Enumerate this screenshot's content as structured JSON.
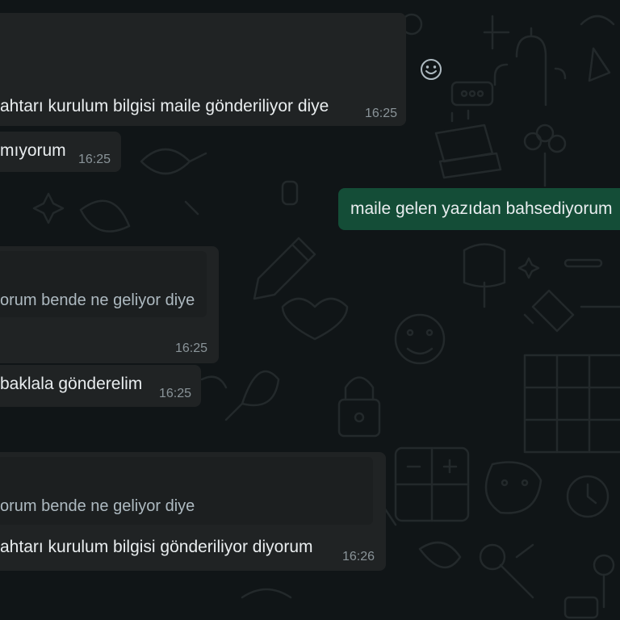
{
  "colors": {
    "background": "#101517",
    "incoming_bubble": "#202324",
    "outgoing_bubble": "#144d37",
    "quote_bubble": "#1c1f20",
    "text": "#e9edef",
    "timestamp": "#8a9499"
  },
  "reaction_icon": "emoji-smile-icon",
  "messages": [
    {
      "direction": "incoming",
      "text": "ahtarı kurulum bilgisi maile gönderiliyor diye",
      "time": "16:25"
    },
    {
      "direction": "incoming",
      "text": "mıyorum",
      "time": "16:25"
    },
    {
      "direction": "outgoing",
      "text": "maile gelen yazıdan bahsediyorum",
      "time": ""
    },
    {
      "direction": "incoming",
      "quote": "orum bende ne geliyor diye",
      "text": "",
      "time": "16:25"
    },
    {
      "direction": "incoming",
      "text": "baklala gönderelim",
      "time": "16:25"
    },
    {
      "direction": "incoming",
      "quote": "orum bende ne geliyor diye",
      "text": "ahtarı kurulum bilgisi gönderiliyor diyorum",
      "time": "16:26"
    }
  ]
}
